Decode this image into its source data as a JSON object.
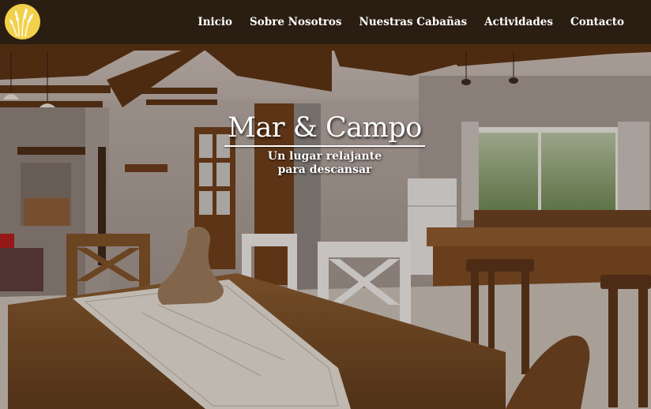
{
  "brand": {
    "logo_icon": "wheat-icon",
    "logo_color": "#f2d04a"
  },
  "nav": {
    "items": [
      {
        "label": "Inicio"
      },
      {
        "label": "Sobre Nosotros"
      },
      {
        "label": "Nuestras Cabañas"
      },
      {
        "label": "Actividades"
      },
      {
        "label": "Contacto"
      }
    ]
  },
  "hero": {
    "title": "Mar & Campo",
    "subtitle_line1": "Un lugar relajante",
    "subtitle_line2": "para descansar",
    "image_description_icon": "cabin-interior-photo"
  },
  "colors": {
    "navbar_bg": "#2a1e12",
    "text": "#ffffff"
  }
}
